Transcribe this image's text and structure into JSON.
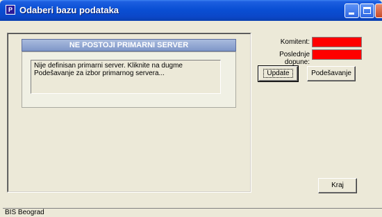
{
  "window": {
    "title": "Odaberi bazu podataka",
    "icon": "app-icon",
    "icon_glyph": "P"
  },
  "panel": {
    "header": "NE POSTOJI PRIMARNI SERVER",
    "message": "Nije definisan primarni server. Kliknite na dugme Podešavanje za izbor primarnog servera..."
  },
  "fields": {
    "komitent_label": "Komitent:",
    "dopune_label": "Poslednje dopune:",
    "field_color": "#ff0000"
  },
  "buttons": {
    "update": "Update",
    "podesavanje": "Podešavanje",
    "kraj": "Kraj"
  },
  "statusbar": {
    "text": "BIS Beograd"
  }
}
